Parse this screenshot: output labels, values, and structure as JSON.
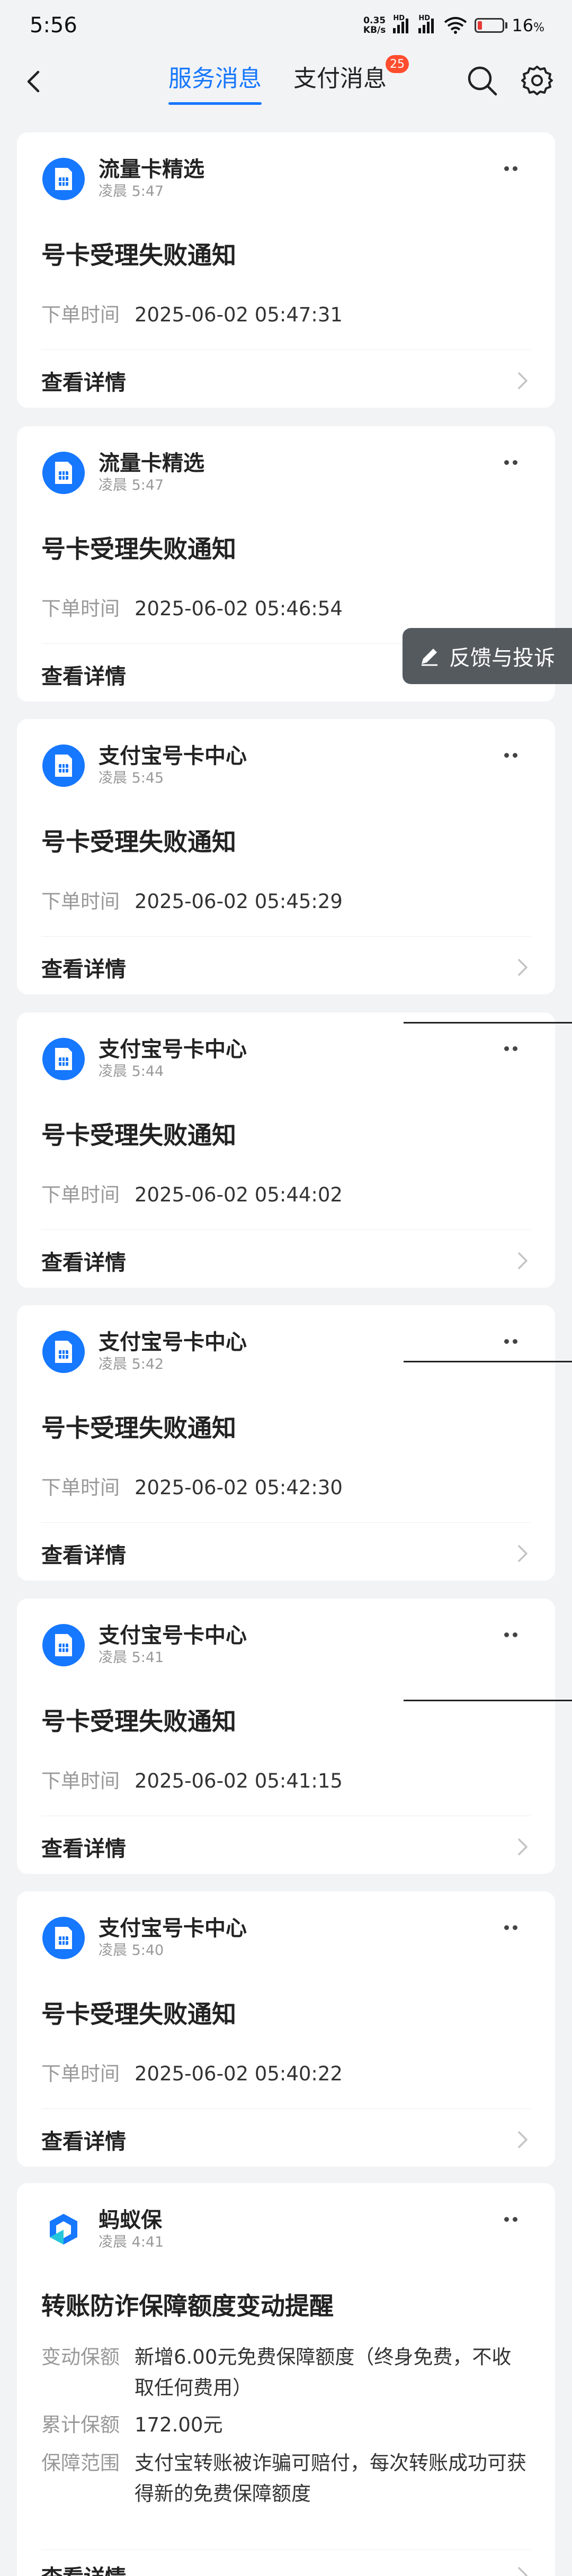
{
  "status_bar": {
    "time": "5:56",
    "net_speed": "0.35",
    "net_unit": "KB/s",
    "sig1": "HD",
    "sig2": "HD",
    "battery_percent": "16",
    "battery_unit": "%",
    "battery_level": 0.16,
    "battery_color": "#e53935"
  },
  "header": {
    "back_icon": "chevron-left-icon",
    "tabs": [
      {
        "label": "服务消息",
        "active": true
      },
      {
        "label": "支付消息",
        "badge": "25"
      }
    ],
    "search_icon": "search-icon",
    "settings_icon": "gear-icon",
    "accent_color": "#1677ff",
    "badge_color": "#ff4d2e"
  },
  "feedback": {
    "label": "反馈与投诉"
  },
  "cards": [
    {
      "source": "流量卡精选",
      "time": "凌晨 5:47",
      "title": "号卡受理失败通知",
      "row_label": "下单时间",
      "row_value": "2025-06-02 05:47:31",
      "link": "查看详情"
    },
    {
      "source": "流量卡精选",
      "time": "凌晨 5:47",
      "title": "号卡受理失败通知",
      "row_label": "下单时间",
      "row_value": "2025-06-02 05:46:54",
      "link": "查看详情"
    },
    {
      "source": "支付宝号卡中心",
      "time": "凌晨 5:45",
      "title": "号卡受理失败通知",
      "row_label": "下单时间",
      "row_value": "2025-06-02 05:45:29",
      "link": "查看详情"
    },
    {
      "source": "支付宝号卡中心",
      "time": "凌晨 5:44",
      "title": "号卡受理失败通知",
      "row_label": "下单时间",
      "row_value": "2025-06-02 05:44:02",
      "link": "查看详情"
    },
    {
      "source": "支付宝号卡中心",
      "time": "凌晨 5:42",
      "title": "号卡受理失败通知",
      "row_label": "下单时间",
      "row_value": "2025-06-02 05:42:30",
      "link": "查看详情"
    },
    {
      "source": "支付宝号卡中心",
      "time": "凌晨 5:41",
      "title": "号卡受理失败通知",
      "row_label": "下单时间",
      "row_value": "2025-06-02 05:41:15",
      "link": "查看详情"
    },
    {
      "source": "支付宝号卡中心",
      "time": "凌晨 5:40",
      "title": "号卡受理失败通知",
      "row_label": "下单时间",
      "row_value": "2025-06-02 05:40:22",
      "link": "查看详情"
    }
  ],
  "last_card": {
    "source": "蚂蚁保",
    "time": "凌晨 4:41",
    "title": "转账防诈保障额度变动提醒",
    "rows": [
      {
        "label": "变动保额",
        "value": "新增6.00元免费保障额度（终身免费，不收取任何费用）"
      },
      {
        "label": "累计保额",
        "value": "172.00元"
      },
      {
        "label": "保障范围",
        "value": "支付宝转账被诈骗可赔付，每次转账成功可获得新的免费保障额度"
      }
    ],
    "link": "查看详情"
  }
}
